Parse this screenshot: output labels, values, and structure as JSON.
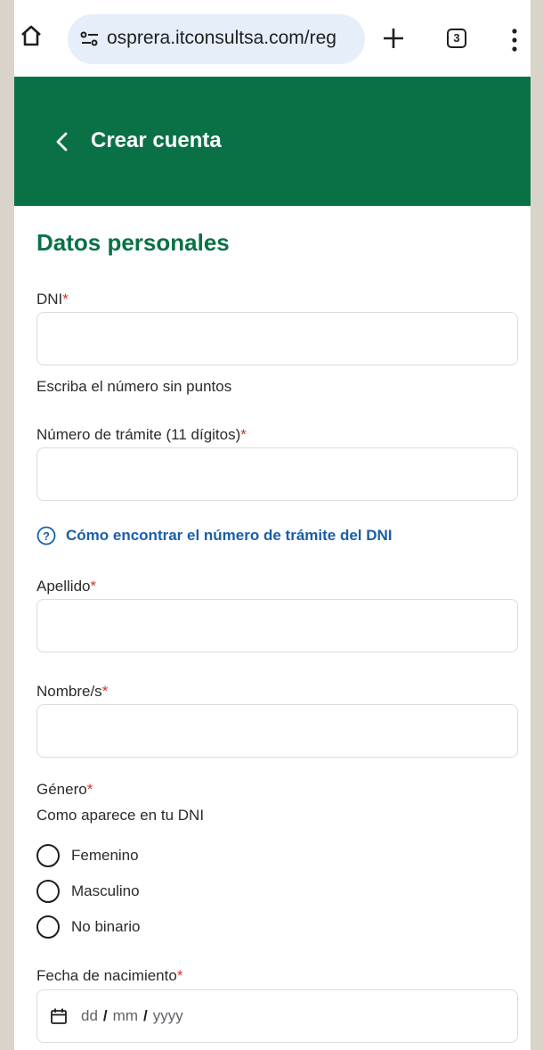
{
  "browser": {
    "url": "osprera.itconsultsa.com/reg",
    "tab_count": "3"
  },
  "header": {
    "title": "Crear cuenta"
  },
  "form": {
    "section_title": "Datos personales",
    "required_mark": "*",
    "dni": {
      "label": "DNI",
      "value": "",
      "hint": "Escriba el número sin puntos"
    },
    "tramite": {
      "label": "Número de trámite (11 dígitos)",
      "value": ""
    },
    "help_link": "Cómo encontrar el número de trámite del DNI",
    "apellido": {
      "label": "Apellido",
      "value": ""
    },
    "nombre": {
      "label": "Nombre/s",
      "value": ""
    },
    "genero": {
      "label": "Género",
      "hint": "Como aparece en tu DNI",
      "options": [
        "Femenino",
        "Masculino",
        "No binario"
      ]
    },
    "fecha": {
      "label": "Fecha de nacimiento",
      "dd": "dd",
      "mm": "mm",
      "yyyy": "yyyy",
      "separator": "/"
    }
  },
  "colors": {
    "header_bg": "#0a7147",
    "accent": "#0a7147",
    "link": "#1a5fa6",
    "required": "#d0342c"
  },
  "icons": [
    "home-icon",
    "site-info-icon",
    "new-tab-icon",
    "tab-switcher-icon",
    "menu-icon",
    "back-icon",
    "help-icon",
    "calendar-icon"
  ]
}
